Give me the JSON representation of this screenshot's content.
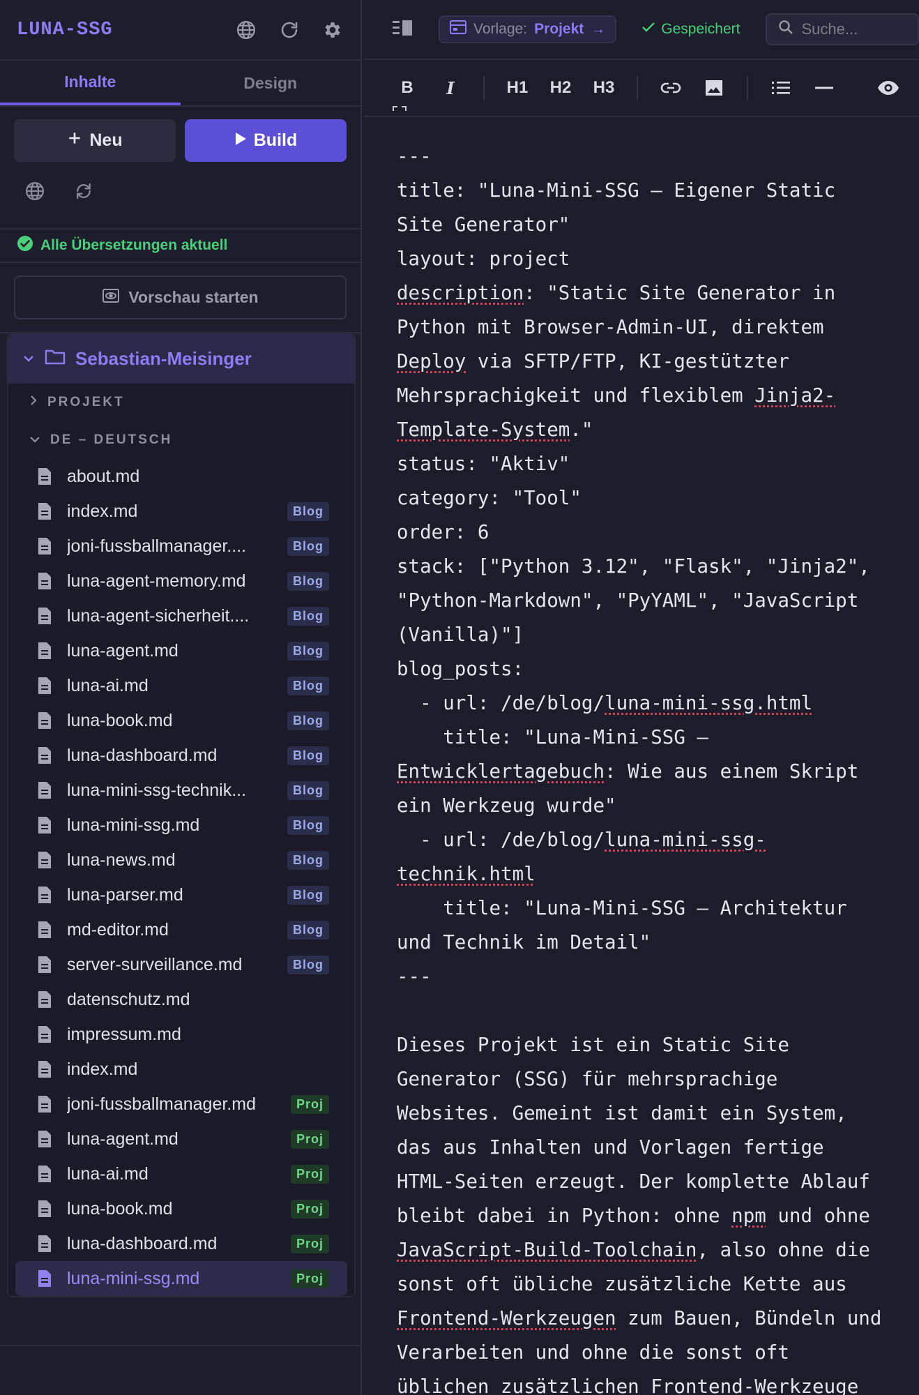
{
  "app": {
    "logo": "LUNA-SSG"
  },
  "tabs": [
    {
      "label": "Inhalte",
      "active": true
    },
    {
      "label": "Design",
      "active": false
    }
  ],
  "actions": {
    "new_label": "Neu",
    "build_label": "Build"
  },
  "status": {
    "translations": "Alle Übersetzungen aktuell"
  },
  "preview": {
    "label": "Vorschau starten"
  },
  "tree": {
    "root_folder": "Sebastian-Meisinger",
    "section_project": "PROJEKT",
    "section_de": "DE – DEUTSCH",
    "files": [
      {
        "name": "about.md",
        "badge": ""
      },
      {
        "name": "index.md",
        "badge": "Blog"
      },
      {
        "name": "joni-fussballmanager....",
        "badge": "Blog"
      },
      {
        "name": "luna-agent-memory.md",
        "badge": "Blog"
      },
      {
        "name": "luna-agent-sicherheit....",
        "badge": "Blog"
      },
      {
        "name": "luna-agent.md",
        "badge": "Blog"
      },
      {
        "name": "luna-ai.md",
        "badge": "Blog"
      },
      {
        "name": "luna-book.md",
        "badge": "Blog"
      },
      {
        "name": "luna-dashboard.md",
        "badge": "Blog"
      },
      {
        "name": "luna-mini-ssg-technik...",
        "badge": "Blog"
      },
      {
        "name": "luna-mini-ssg.md",
        "badge": "Blog"
      },
      {
        "name": "luna-news.md",
        "badge": "Blog"
      },
      {
        "name": "luna-parser.md",
        "badge": "Blog"
      },
      {
        "name": "md-editor.md",
        "badge": "Blog"
      },
      {
        "name": "server-surveillance.md",
        "badge": "Blog"
      },
      {
        "name": "datenschutz.md",
        "badge": ""
      },
      {
        "name": "impressum.md",
        "badge": ""
      },
      {
        "name": "index.md",
        "badge": ""
      },
      {
        "name": "joni-fussballmanager.md",
        "badge": "Proj"
      },
      {
        "name": "luna-agent.md",
        "badge": "Proj"
      },
      {
        "name": "luna-ai.md",
        "badge": "Proj"
      },
      {
        "name": "luna-book.md",
        "badge": "Proj"
      },
      {
        "name": "luna-dashboard.md",
        "badge": "Proj"
      },
      {
        "name": "luna-mini-ssg.md",
        "badge": "Proj",
        "selected": true
      }
    ]
  },
  "editor": {
    "template_label": "Vorlage:",
    "template_value": "Projekt",
    "template_arrow": "→",
    "saved_label": "Gespeichert",
    "search_placeholder": "Suche...",
    "toolbar": {
      "bold": "B",
      "italic": "I",
      "h1": "H1",
      "h2": "H2",
      "h3": "H3"
    },
    "lines": [
      [
        {
          "t": "---"
        }
      ],
      [
        {
          "t": "title: \"Luna-Mini-SSG – Eigener Static"
        }
      ],
      [
        {
          "t": "Site Generator\""
        }
      ],
      [
        {
          "t": "layout: project"
        }
      ],
      [
        {
          "t": "description",
          "u": true
        },
        {
          "t": ": \"Static Site Generator in"
        }
      ],
      [
        {
          "t": "Python mit Browser-Admin-UI, direktem"
        }
      ],
      [
        {
          "t": "Deploy",
          "u": true
        },
        {
          "t": " via SFTP/FTP, KI-gestützter"
        }
      ],
      [
        {
          "t": "Mehrsprachigkeit und flexiblem "
        },
        {
          "t": "Jinja2-",
          "u": true
        }
      ],
      [
        {
          "t": "Template-System",
          "u": true
        },
        {
          "t": ".\""
        }
      ],
      [
        {
          "t": "status: \"Aktiv\""
        }
      ],
      [
        {
          "t": "category: \"Tool\""
        }
      ],
      [
        {
          "t": "order: 6"
        }
      ],
      [
        {
          "t": "stack: [\"Python 3.12\", \"Flask\", \"Jinja2\","
        }
      ],
      [
        {
          "t": "\"Python-Markdown\", \"PyYAML\", \"JavaScript"
        }
      ],
      [
        {
          "t": "(Vanilla)\"]"
        }
      ],
      [
        {
          "t": "blog_posts:"
        }
      ],
      [
        {
          "t": "  - url: /de/blog/"
        },
        {
          "t": "luna-mini-ssg.html",
          "u": true
        }
      ],
      [
        {
          "t": "    title: \"Luna-Mini-SSG –"
        }
      ],
      [
        {
          "t": "Entwicklertagebuch",
          "u": true
        },
        {
          "t": ": Wie aus einem Skript"
        }
      ],
      [
        {
          "t": "ein Werkzeug wurde\""
        }
      ],
      [
        {
          "t": "  - url: /de/blog/"
        },
        {
          "t": "luna-mini-ssg-",
          "u": true
        }
      ],
      [
        {
          "t": "technik.html",
          "u": true
        }
      ],
      [
        {
          "t": "    title: \"Luna-Mini-SSG – Architektur"
        }
      ],
      [
        {
          "t": "und Technik im Detail\""
        }
      ],
      [
        {
          "t": "---"
        }
      ],
      [
        {
          "t": ""
        }
      ],
      [
        {
          "t": "Dieses Projekt ist ein Static Site"
        }
      ],
      [
        {
          "t": "Generator (SSG) für mehrsprachige"
        }
      ],
      [
        {
          "t": "Websites. Gemeint ist damit ein System,"
        }
      ],
      [
        {
          "t": "das aus Inhalten und Vorlagen fertige"
        }
      ],
      [
        {
          "t": "HTML-Seiten erzeugt. Der komplette Ablauf"
        }
      ],
      [
        {
          "t": "bleibt dabei in Python: ohne "
        },
        {
          "t": "npm",
          "u": true
        },
        {
          "t": " und ohne"
        }
      ],
      [
        {
          "t": "JavaScript-Build-Toolchain",
          "u": true
        },
        {
          "t": ", also ohne die"
        }
      ],
      [
        {
          "t": "sonst oft übliche zusätzliche Kette aus"
        }
      ],
      [
        {
          "t": "Frontend-Werkzeugen",
          "u": true
        },
        {
          "t": " zum Bauen, Bündeln und"
        }
      ],
      [
        {
          "t": "Verarbeiten und ohne die sonst oft"
        }
      ],
      [
        {
          "t": "üblichen zusätzlichen Frontend-Werkzeuge"
        }
      ]
    ]
  },
  "colors": {
    "accent": "#8b7cf6",
    "build_button": "#5b4fd6",
    "success": "#4ad07a",
    "blog_badge": "#9ca8e8",
    "proj_badge": "#6fd88a"
  }
}
